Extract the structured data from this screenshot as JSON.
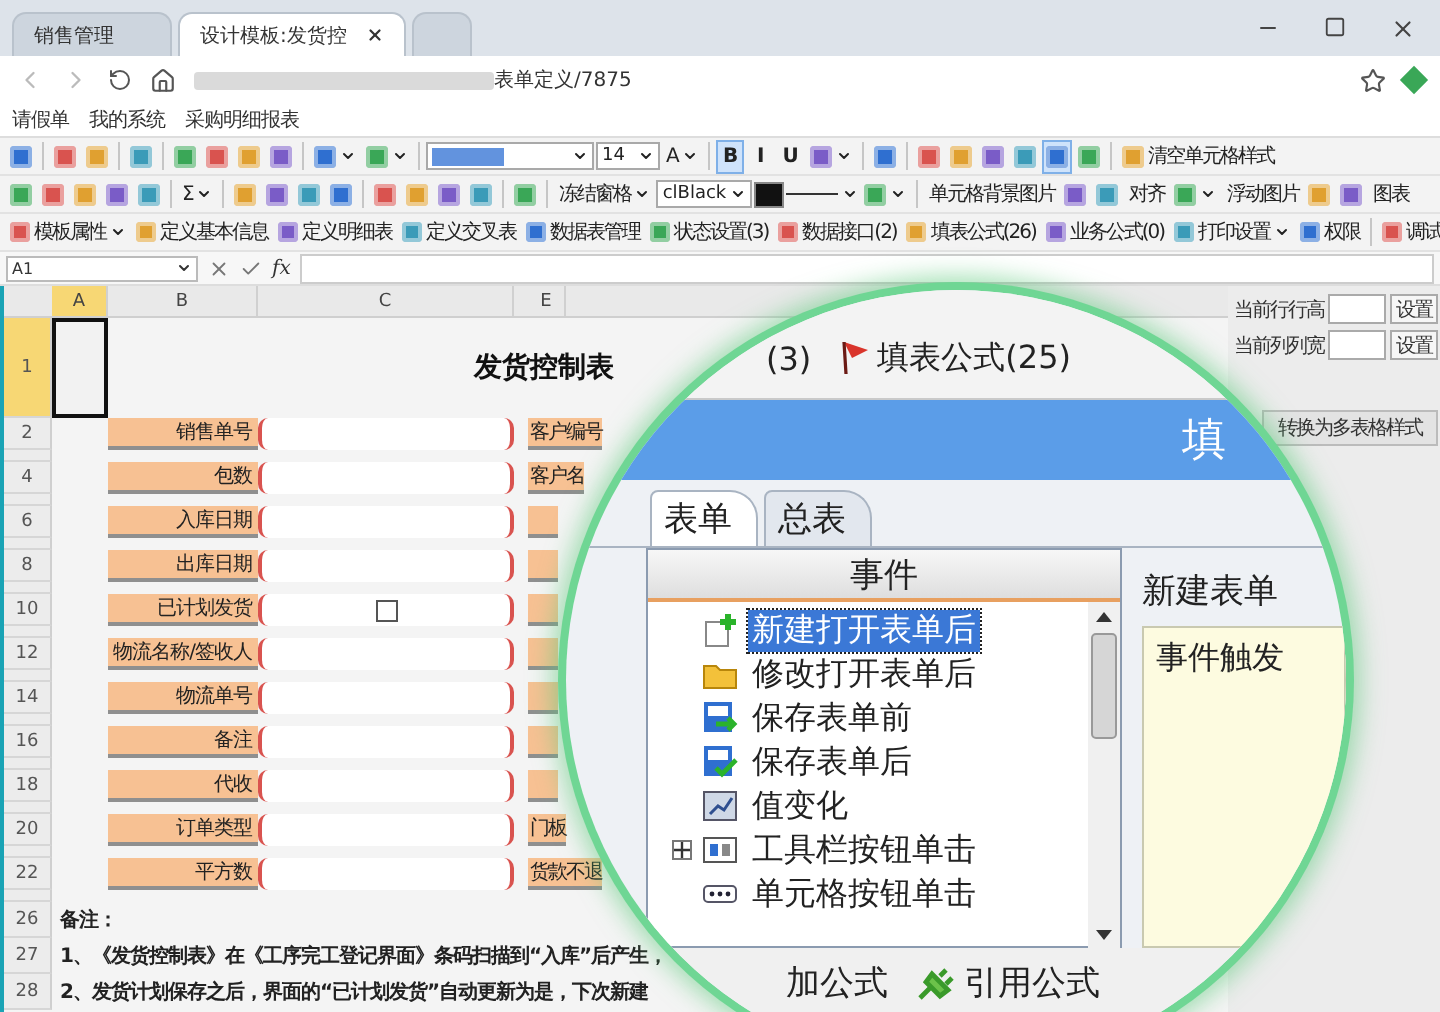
{
  "browser_tabs": [
    {
      "label": "销售管理",
      "selected": false,
      "closable": false
    },
    {
      "label": "设计模板:发货控",
      "selected": true,
      "closable": true
    },
    {
      "selected": false,
      "closable": false
    }
  ],
  "address_bar": {
    "url": "表单定义/7875"
  },
  "bookmarks": [
    "请假单",
    "我的系统",
    "采购明细报表"
  ],
  "toolbar_rows": [
    [
      {
        "kind": "icon"
      },
      {
        "kind": "sep"
      },
      {
        "kind": "icon"
      },
      {
        "kind": "icon"
      },
      {
        "kind": "sep"
      },
      {
        "kind": "icon"
      },
      {
        "kind": "sep"
      },
      {
        "kind": "icon"
      },
      {
        "kind": "icon"
      },
      {
        "kind": "icon"
      },
      {
        "kind": "icon"
      },
      {
        "kind": "sep"
      },
      {
        "kind": "menu",
        "icon": true
      },
      {
        "kind": "menu",
        "icon": true
      },
      {
        "kind": "sep"
      },
      {
        "kind": "font_select"
      },
      {
        "kind": "select",
        "value": "14"
      },
      {
        "kind": "menu",
        "icon": false,
        "label": "A"
      },
      {
        "kind": "sep"
      },
      {
        "kind": "toggle",
        "label": "B",
        "selected": true
      },
      {
        "kind": "toggle",
        "label": "I",
        "selected": false
      },
      {
        "kind": "toggle",
        "label": "U",
        "selected": false
      },
      {
        "kind": "menu",
        "icon": true
      },
      {
        "kind": "sep"
      },
      {
        "kind": "icon"
      },
      {
        "kind": "sep"
      },
      {
        "kind": "toggle_icon",
        "selected": false
      },
      {
        "kind": "toggle_icon",
        "selected": false
      },
      {
        "kind": "toggle_icon",
        "selected": false
      },
      {
        "kind": "toggle_icon",
        "selected": false
      },
      {
        "kind": "toggle_icon",
        "selected": true
      },
      {
        "kind": "toggle_icon",
        "selected": false
      },
      {
        "kind": "sep"
      },
      {
        "kind": "button",
        "icon": true,
        "label": "清空单元格样式"
      }
    ],
    [
      {
        "kind": "icon"
      },
      {
        "kind": "icon"
      },
      {
        "kind": "icon"
      },
      {
        "kind": "icon"
      },
      {
        "kind": "icon"
      },
      {
        "kind": "sep"
      },
      {
        "kind": "menu",
        "icon": false,
        "label": "Σ"
      },
      {
        "kind": "sep"
      },
      {
        "kind": "icon"
      },
      {
        "kind": "icon"
      },
      {
        "kind": "icon"
      },
      {
        "kind": "icon"
      },
      {
        "kind": "sep"
      },
      {
        "kind": "icon"
      },
      {
        "kind": "icon"
      },
      {
        "kind": "icon"
      },
      {
        "kind": "icon"
      },
      {
        "kind": "sep"
      },
      {
        "kind": "icon"
      },
      {
        "kind": "sep"
      },
      {
        "kind": "menu",
        "icon": false,
        "label": "冻结窗格"
      },
      {
        "kind": "select",
        "value": "clBlack"
      },
      {
        "kind": "swatch"
      },
      {
        "kind": "line_style"
      },
      {
        "kind": "menu",
        "icon": true
      },
      {
        "kind": "sep"
      },
      {
        "kind": "button",
        "icon": false,
        "label": "单元格背景图片"
      },
      {
        "kind": "icon"
      },
      {
        "kind": "icon"
      },
      {
        "kind": "button",
        "icon": false,
        "label": "对齐"
      },
      {
        "kind": "menu",
        "icon": true
      },
      {
        "kind": "button",
        "icon": false,
        "label": "浮动图片"
      },
      {
        "kind": "icon"
      },
      {
        "kind": "icon"
      },
      {
        "kind": "button",
        "icon": false,
        "label": "图表"
      }
    ],
    [
      {
        "kind": "menu",
        "icon": true,
        "label": "模板属性"
      },
      {
        "kind": "button",
        "icon": true,
        "label": "定义基本信息"
      },
      {
        "kind": "button",
        "icon": true,
        "label": "定义明细表"
      },
      {
        "kind": "button",
        "icon": true,
        "label": "定义交叉表"
      },
      {
        "kind": "button",
        "icon": true,
        "label": "数据表管理"
      },
      {
        "kind": "button",
        "icon": true,
        "label": "状态设置(3)"
      },
      {
        "kind": "button",
        "icon": true,
        "label": "数据接口(2)"
      },
      {
        "kind": "button",
        "icon": true,
        "label": "填表公式(26)"
      },
      {
        "kind": "button",
        "icon": true,
        "label": "业务公式(0)"
      },
      {
        "kind": "menu",
        "icon": true,
        "label": "打印设置"
      },
      {
        "kind": "button",
        "icon": true,
        "label": "权限"
      },
      {
        "kind": "sep"
      },
      {
        "kind": "menu",
        "icon": true,
        "label": "调试"
      }
    ]
  ],
  "formula_bar": {
    "cell": "A1",
    "function_label": "fx"
  },
  "sheet": {
    "columns": [
      {
        "label": "A",
        "selected": true
      },
      {
        "label": "B",
        "selected": false
      },
      {
        "label": "C",
        "selected": false
      },
      {
        "label": "E",
        "selected": false
      }
    ],
    "title_row": {
      "number": "1",
      "selected": true
    },
    "title": "发货控制表",
    "rows": [
      {
        "number": "2",
        "label": "销售单号",
        "kind": "text",
        "right_label": "客户编号"
      },
      {
        "number": "4",
        "label": "包数",
        "kind": "text",
        "right_label": "客户名"
      },
      {
        "number": "6",
        "label": "入库日期",
        "kind": "text"
      },
      {
        "number": "8",
        "label": "出库日期",
        "kind": "text"
      },
      {
        "number": "10",
        "label": "已计划发货",
        "kind": "checkbox",
        "checked": false
      },
      {
        "number": "12",
        "label": "物流名称/签收人",
        "kind": "text"
      },
      {
        "number": "14",
        "label": "物流单号",
        "kind": "text"
      },
      {
        "number": "16",
        "label": "备注",
        "kind": "text"
      },
      {
        "number": "18",
        "label": "代收",
        "kind": "text"
      },
      {
        "number": "20",
        "label": "订单类型",
        "kind": "text",
        "right_label": "门板"
      },
      {
        "number": "22",
        "label": "平方数",
        "kind": "text",
        "right_label": "货款不退"
      }
    ],
    "notes": [
      {
        "number": "26",
        "text": "备注："
      },
      {
        "number": "27",
        "text": "1、《发货控制表》在《工序完工登记界面》条码扫描到“入库”后产生，"
      },
      {
        "number": "28",
        "text": "2、发货计划保存之后，界面的“已计划发货”自动更新为是，下次新建"
      }
    ]
  },
  "side_panel": {
    "row_height": {
      "label": "当前行行高",
      "button": "设置"
    },
    "col_width": {
      "label": "当前列列宽",
      "button": "设置"
    },
    "convert_button": "转换为多表格样式"
  },
  "magnifier": {
    "toolbar": [
      {
        "kind": "text",
        "label": "(3)"
      },
      {
        "kind": "flag",
        "label": "填表公式(25)"
      }
    ],
    "banner_title": "填",
    "tabs": [
      {
        "label": "表单",
        "selected": true
      },
      {
        "label": "总表",
        "selected": false
      }
    ],
    "events_header": "事件",
    "events": [
      {
        "kind": "new",
        "label": "新建打开表单后",
        "selected": true
      },
      {
        "kind": "open",
        "label": "修改打开表单后",
        "selected": false
      },
      {
        "kind": "save_before",
        "label": "保存表单前",
        "selected": false
      },
      {
        "kind": "save_after",
        "label": "保存表单后",
        "selected": false
      },
      {
        "kind": "value",
        "label": "值变化",
        "selected": false
      },
      {
        "kind": "toolbar",
        "label": "工具栏按钮单击",
        "selected": false,
        "expanded": false
      },
      {
        "kind": "cell_button",
        "label": "单元格按钮单击",
        "selected": false
      }
    ],
    "detail_title": "新建表单",
    "detail_text": "事件触发",
    "actions": [
      {
        "kind": "plain",
        "label": "加公式"
      },
      {
        "kind": "plug",
        "label": "引用公式"
      }
    ]
  }
}
